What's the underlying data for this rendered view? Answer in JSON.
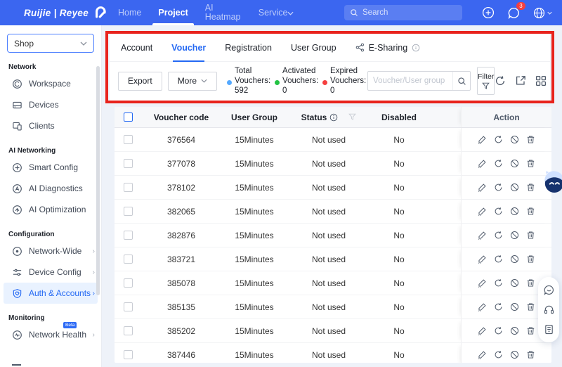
{
  "topbar": {
    "brand": "Ruijie | Reyee",
    "nav": [
      {
        "label": "Home"
      },
      {
        "label": "Project",
        "active": true
      },
      {
        "label": "AI Heatmap"
      },
      {
        "label": "Service"
      }
    ],
    "search_placeholder": "Search",
    "notification_count": "3"
  },
  "sidebar": {
    "scope_selector_value": "Shop",
    "sections": [
      {
        "title": "Network",
        "items": [
          {
            "label": "Workspace",
            "icon": "workspace-icon"
          },
          {
            "label": "Devices",
            "icon": "devices-icon"
          },
          {
            "label": "Clients",
            "icon": "clients-icon"
          }
        ]
      },
      {
        "title": "AI Networking",
        "items": [
          {
            "label": "Smart Config",
            "icon": "smart-config-icon"
          },
          {
            "label": "AI Diagnostics",
            "icon": "ai-diagnostics-icon"
          },
          {
            "label": "AI Optimization",
            "icon": "ai-optimization-icon"
          }
        ]
      },
      {
        "title": "Configuration",
        "items": [
          {
            "label": "Network-Wide",
            "icon": "network-wide-icon",
            "has_submenu": true
          },
          {
            "label": "Device Config",
            "icon": "device-config-icon",
            "has_submenu": true
          },
          {
            "label": "Auth & Accounts",
            "icon": "auth-accounts-icon",
            "has_submenu": true,
            "active": true
          }
        ]
      },
      {
        "title": "Monitoring",
        "items": [
          {
            "label": "Network Health",
            "icon": "network-health-icon",
            "has_submenu": true,
            "badge": "Beta"
          }
        ]
      }
    ]
  },
  "tabs": [
    {
      "label": "Account"
    },
    {
      "label": "Voucher",
      "active": true
    },
    {
      "label": "Registration"
    },
    {
      "label": "User Group"
    },
    {
      "label": "E-Sharing",
      "icon": "share-icon",
      "has_info": true
    }
  ],
  "toolbar": {
    "export_label": "Export",
    "more_label": "More",
    "stats": [
      {
        "label": "Total Vouchers:",
        "value": "592",
        "dot_color": "#54a9ff"
      },
      {
        "label": "Activated Vouchers:",
        "value": "0",
        "dot_color": "#23c343"
      },
      {
        "label": "Expired Vouchers:",
        "value": "0",
        "dot_color": "#f53f3f"
      }
    ],
    "search_placeholder": "Voucher/User group",
    "filter_label": "Filter"
  },
  "table": {
    "headers": {
      "voucher_code": "Voucher code",
      "user_group": "User Group",
      "status": "Status",
      "disabled": "Disabled",
      "action": "Action"
    },
    "row_actions": [
      "edit",
      "renew",
      "disable",
      "delete"
    ],
    "rows": [
      {
        "voucher_code": "376564",
        "user_group": "15Minutes",
        "status": "Not used",
        "disabled": "No"
      },
      {
        "voucher_code": "377078",
        "user_group": "15Minutes",
        "status": "Not used",
        "disabled": "No"
      },
      {
        "voucher_code": "378102",
        "user_group": "15Minutes",
        "status": "Not used",
        "disabled": "No"
      },
      {
        "voucher_code": "382065",
        "user_group": "15Minutes",
        "status": "Not used",
        "disabled": "No"
      },
      {
        "voucher_code": "382876",
        "user_group": "15Minutes",
        "status": "Not used",
        "disabled": "No"
      },
      {
        "voucher_code": "383721",
        "user_group": "15Minutes",
        "status": "Not used",
        "disabled": "No"
      },
      {
        "voucher_code": "385078",
        "user_group": "15Minutes",
        "status": "Not used",
        "disabled": "No"
      },
      {
        "voucher_code": "385135",
        "user_group": "15Minutes",
        "status": "Not used",
        "disabled": "No"
      },
      {
        "voucher_code": "385202",
        "user_group": "15Minutes",
        "status": "Not used",
        "disabled": "No"
      },
      {
        "voucher_code": "387446",
        "user_group": "15Minutes",
        "status": "Not used",
        "disabled": "No"
      }
    ]
  },
  "floating": {
    "assistant": "ai-assistant-mascot",
    "buttons": [
      "message",
      "support",
      "feedback"
    ]
  },
  "colors": {
    "topbar_blue": "#3b66f0",
    "accent_blue": "#2469f3",
    "annotation_red": "#e8231d",
    "total_dot": "#54a9ff",
    "activated_dot": "#23c343",
    "expired_dot": "#f53f3f",
    "badge_red": "#f53f3f"
  }
}
